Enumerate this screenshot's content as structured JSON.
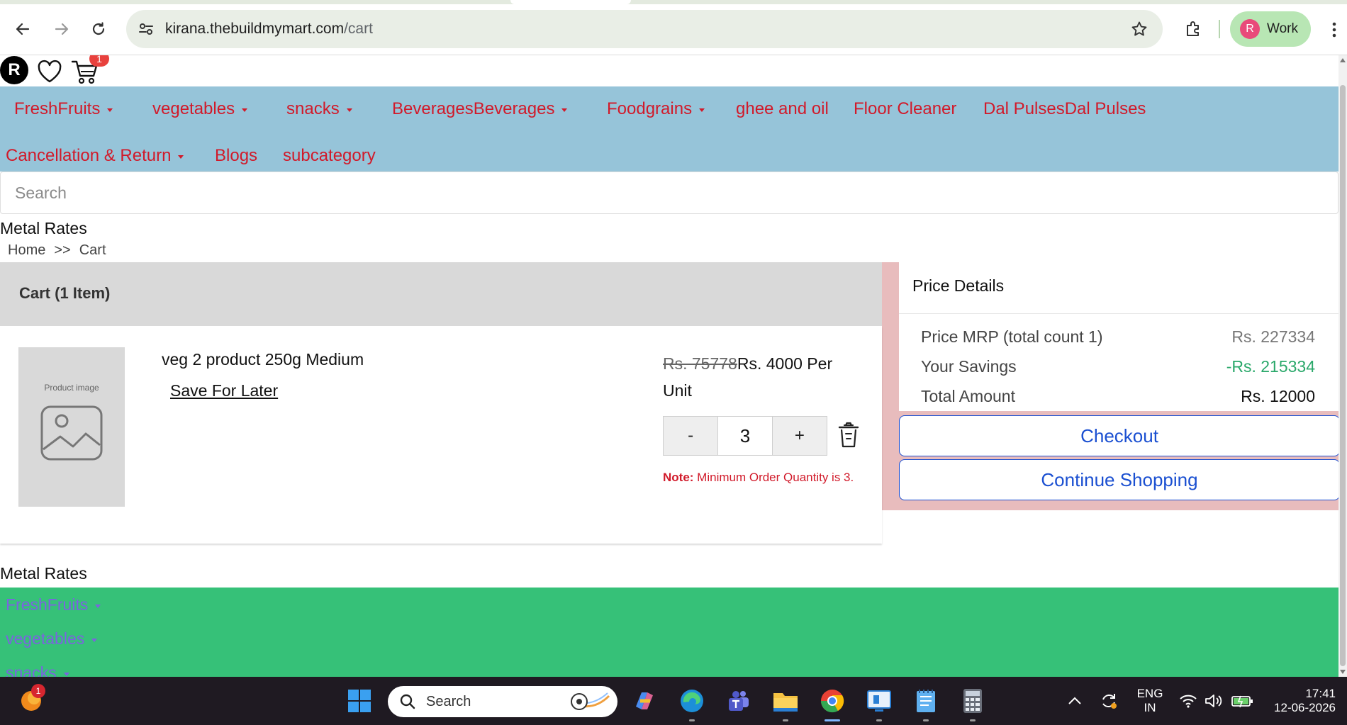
{
  "browser": {
    "url_host": "kirana.thebuildmymart.com",
    "url_path": "/cart",
    "profile_initial": "R",
    "profile_label": "Work"
  },
  "header": {
    "avatar_initial": "R",
    "cart_count": "1"
  },
  "categories": [
    {
      "label": "FreshFruits",
      "dropdown": true
    },
    {
      "label": "vegetables",
      "dropdown": true
    },
    {
      "label": "snacks",
      "dropdown": true
    },
    {
      "label": "BeveragesBeverages",
      "dropdown": true
    },
    {
      "label": "Foodgrains",
      "dropdown": true
    },
    {
      "label": "ghee and oil",
      "dropdown": false
    },
    {
      "label": "Floor Cleaner",
      "dropdown": false
    },
    {
      "label": "Dal PulsesDal Pulses",
      "dropdown": false
    },
    {
      "label": "Cancellation & Return",
      "dropdown": true
    },
    {
      "label": "Blogs",
      "dropdown": false
    },
    {
      "label": "subcategory",
      "dropdown": false
    }
  ],
  "search": {
    "placeholder": "Search"
  },
  "metal_rates_label": "Metal Rates",
  "breadcrumb": {
    "home": "Home",
    "sep": ">>",
    "current": "Cart"
  },
  "cart": {
    "title": "Cart (1 Item)",
    "item": {
      "image_caption": "Product image",
      "name": "veg 2 product 250g Medium",
      "save_for_later": "Save For Later",
      "mrp": "Rs. 75778",
      "price": "Rs. 4000 Per Unit",
      "qty_minus": "-",
      "qty_value": "3",
      "qty_plus": "+",
      "note_label": "Note:",
      "note_text": " Minimum Order Quantity is 3."
    }
  },
  "price_details": {
    "title": "Price Details",
    "mrp_label": "Price MRP (total count 1)",
    "mrp_value": "Rs. 227334",
    "savings_label": "Your Savings",
    "savings_value": "-Rs. 215334",
    "total_label": "Total Amount",
    "total_value": "Rs. 12000",
    "checkout": "Checkout",
    "continue": "Continue Shopping"
  },
  "footer": {
    "metal_rates_label": "Metal Rates",
    "items": [
      "FreshFruits",
      "vegetables",
      "snacks"
    ]
  },
  "taskbar": {
    "notification_count": "1",
    "search_label": "Search",
    "lang_top": "ENG",
    "lang_bottom": "IN",
    "time": "17:41",
    "date": "12-06-2026"
  },
  "colors": {
    "nav_bg": "#96c4d9",
    "nav_text": "#d11a2a",
    "cart_bg": "#e8bcbd",
    "footer_bg": "#36c178",
    "footer_text": "#7b63e0",
    "button_blue": "#1a4fd1",
    "savings_green": "#2aa86a"
  }
}
